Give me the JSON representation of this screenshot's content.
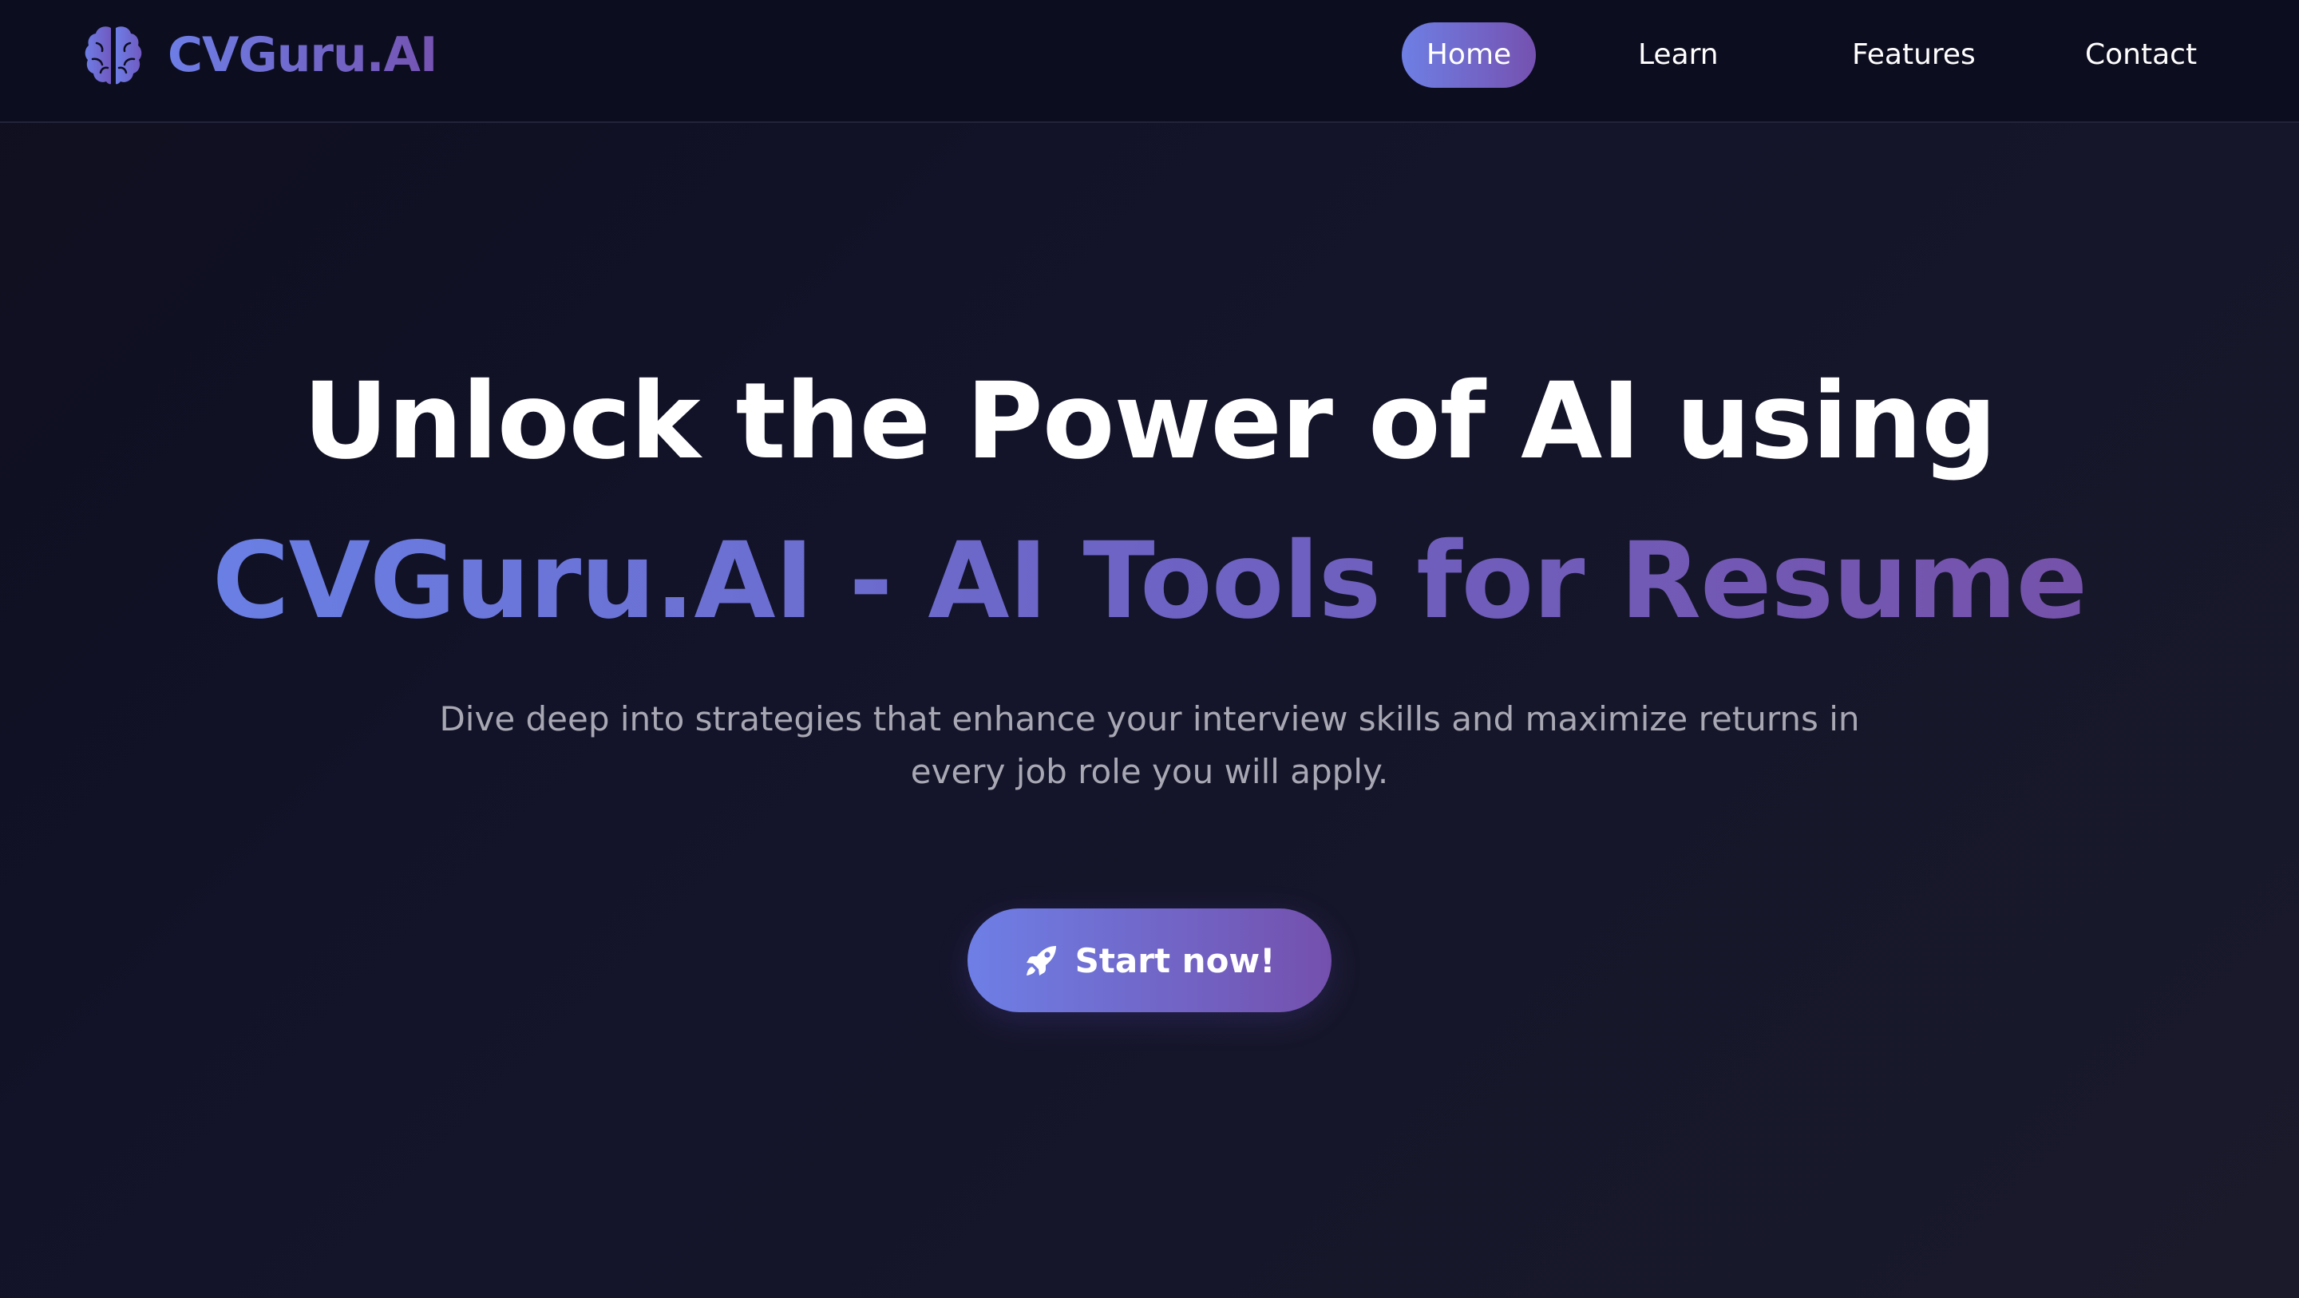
{
  "brand": {
    "name": "CVGuru.AI",
    "icon": "brain-icon",
    "gradient": [
      "#6d7ee6",
      "#7553b2"
    ]
  },
  "nav": {
    "active": "Home",
    "items": [
      {
        "label": "Home"
      },
      {
        "label": "Learn"
      },
      {
        "label": "Features"
      },
      {
        "label": "Contact"
      }
    ]
  },
  "hero": {
    "title": "Unlock the Power of AI using",
    "subtitle": "CVGuru.AI - AI Tools for Resume",
    "description": "Dive deep into strategies that enhance your interview skills and maximize returns in every job role you will apply.",
    "cta": {
      "label": "Start now!",
      "icon": "rocket-icon"
    }
  },
  "colors": {
    "background": "#13132a",
    "navbar": "#0d0d20",
    "accent_start": "#6e7fe6",
    "accent_end": "#7450ad",
    "muted_text": "#a8a8b4"
  }
}
